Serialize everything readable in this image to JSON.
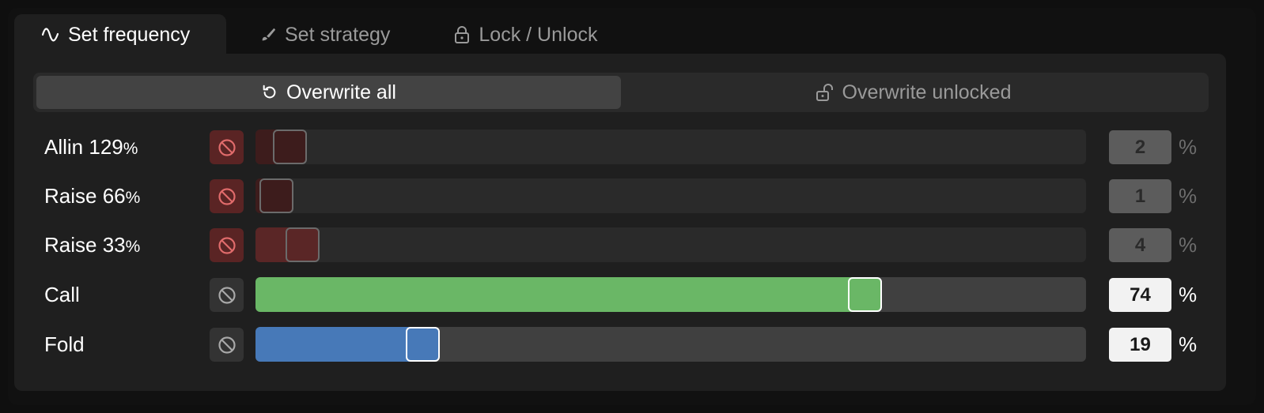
{
  "tabs": [
    {
      "label": "Set frequency",
      "icon": "wave-icon",
      "active": true
    },
    {
      "label": "Set strategy",
      "icon": "brush-icon",
      "active": false
    },
    {
      "label": "Lock / Unlock",
      "icon": "lock-icon",
      "active": false
    }
  ],
  "overwrite": {
    "all_label": "Overwrite all",
    "all_icon": "reset-icon",
    "unlocked_label": "Overwrite unlocked",
    "unlocked_icon": "unlock-icon",
    "selected": "all"
  },
  "actions": [
    {
      "name": "Allin 129",
      "suffix": "%",
      "value": "2",
      "unit": "%",
      "blocked": true,
      "color": "#3d1c1c"
    },
    {
      "name": "Raise 66",
      "suffix": "%",
      "value": "1",
      "unit": "%",
      "blocked": true,
      "color": "#3d1c1c"
    },
    {
      "name": "Raise 33",
      "suffix": "%",
      "value": "4",
      "unit": "%",
      "blocked": true,
      "color": "#5a2626"
    },
    {
      "name": "Call",
      "suffix": "",
      "value": "74",
      "unit": "%",
      "blocked": false,
      "color": "#6ab766"
    },
    {
      "name": "Fold",
      "suffix": "",
      "value": "19",
      "unit": "%",
      "blocked": false,
      "color": "#4779b8"
    }
  ],
  "colors": {
    "background": "#111111",
    "panel": "#1f1f1f",
    "blocked_button": "#5a2424",
    "block_icon_red": "#e06b6b",
    "track_active": "#404040",
    "track_blocked": "#2a2a2a"
  }
}
